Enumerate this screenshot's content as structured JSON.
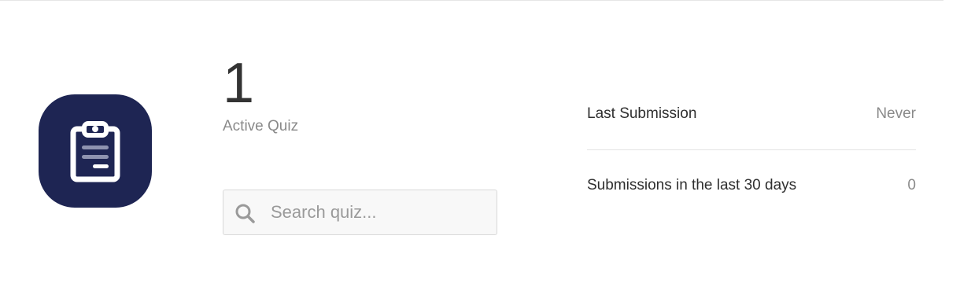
{
  "quiz": {
    "count": "1",
    "count_label": "Active Quiz",
    "icon": "clipboard-icon"
  },
  "search": {
    "placeholder": "Search quiz...",
    "value": "",
    "icon": "search-icon"
  },
  "stats": [
    {
      "label": "Last Submission",
      "value": "Never"
    },
    {
      "label": "Submissions in the last 30 days",
      "value": "0"
    }
  ],
  "colors": {
    "icon_bg": "#1e2553",
    "muted_text": "#8a8a8a",
    "primary_text": "#333333"
  }
}
